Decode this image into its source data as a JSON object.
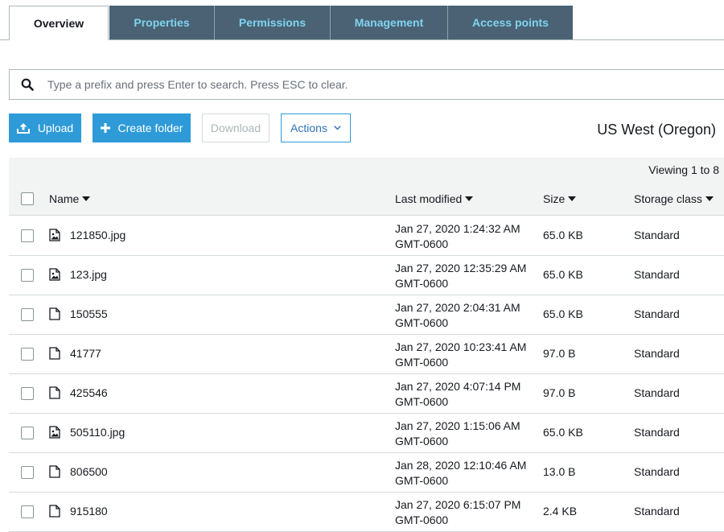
{
  "tabs": [
    "Overview",
    "Properties",
    "Permissions",
    "Management",
    "Access points"
  ],
  "search": {
    "placeholder": "Type a prefix and press Enter to search. Press ESC to clear."
  },
  "toolbar": {
    "upload": "Upload",
    "create_folder": "Create folder",
    "download": "Download",
    "actions": "Actions"
  },
  "region": "US West (Oregon)",
  "viewing": "Viewing 1 to 8",
  "columns": {
    "name": "Name",
    "last_modified": "Last modified",
    "size": "Size",
    "storage_class": "Storage class"
  },
  "rows": [
    {
      "name": "121850.jpg",
      "icon": "image-file-icon",
      "date": "Jan 27, 2020 1:24:32 AM",
      "tz": "GMT-0600",
      "size": "65.0 KB",
      "class": "Standard"
    },
    {
      "name": "123.jpg",
      "icon": "image-file-icon",
      "date": "Jan 27, 2020 12:35:29 AM",
      "tz": "GMT-0600",
      "size": "65.0 KB",
      "class": "Standard"
    },
    {
      "name": "150555",
      "icon": "file-icon",
      "date": "Jan 27, 2020 2:04:31 AM",
      "tz": "GMT-0600",
      "size": "65.0 KB",
      "class": "Standard"
    },
    {
      "name": "41777",
      "icon": "file-icon",
      "date": "Jan 27, 2020 10:23:41 AM",
      "tz": "GMT-0600",
      "size": "97.0 B",
      "class": "Standard"
    },
    {
      "name": "425546",
      "icon": "file-icon",
      "date": "Jan 27, 2020 4:07:14 PM",
      "tz": "GMT-0600",
      "size": "97.0 B",
      "class": "Standard"
    },
    {
      "name": "505110.jpg",
      "icon": "image-file-icon",
      "date": "Jan 27, 2020 1:15:06 AM",
      "tz": "GMT-0600",
      "size": "65.0 KB",
      "class": "Standard"
    },
    {
      "name": "806500",
      "icon": "file-icon",
      "date": "Jan 28, 2020 12:10:46 AM",
      "tz": "GMT-0600",
      "size": "13.0 B",
      "class": "Standard"
    },
    {
      "name": "915180",
      "icon": "file-icon",
      "date": "Jan 27, 2020 6:15:07 PM",
      "tz": "GMT-0600",
      "size": "2.4 KB",
      "class": "Standard"
    }
  ]
}
